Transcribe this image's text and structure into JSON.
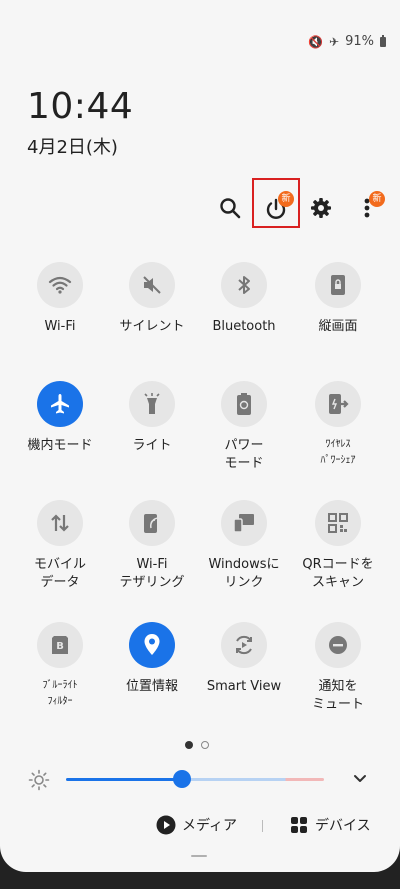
{
  "status": {
    "battery": "91%"
  },
  "clock": {
    "time": "10:44",
    "date": "4月2日(木)"
  },
  "toolbar": {
    "power_badge": "新",
    "menu_badge": "新"
  },
  "tiles": [
    {
      "label": "Wi-Fi",
      "icon": "wifi-icon"
    },
    {
      "label": "サイレント",
      "icon": "mute-icon"
    },
    {
      "label": "Bluetooth",
      "icon": "bluetooth-icon"
    },
    {
      "label": "縦画面",
      "icon": "portrait-lock-icon"
    },
    {
      "label": "機内モード",
      "icon": "airplane-icon",
      "active": true
    },
    {
      "label": "ライト",
      "icon": "flashlight-icon"
    },
    {
      "label": "パワー\nモード",
      "icon": "power-mode-icon"
    },
    {
      "label": "ﾜｲﾔﾚｽ\nﾊﾟﾜｰｼｪｱ",
      "icon": "wireless-powershare-icon"
    },
    {
      "label": "モバイル\nデータ",
      "icon": "mobile-data-icon"
    },
    {
      "label": "Wi-Fi\nテザリング",
      "icon": "hotspot-icon"
    },
    {
      "label": "Windowsに\nリンク",
      "icon": "link-to-windows-icon"
    },
    {
      "label": "QRコードを\nスキャン",
      "icon": "qr-code-icon"
    },
    {
      "label": "ﾌﾞﾙｰﾗｲﾄ\nﾌｨﾙﾀｰ",
      "icon": "blue-light-filter-icon"
    },
    {
      "label": "位置情報",
      "icon": "location-icon",
      "active": true
    },
    {
      "label": "Smart View",
      "icon": "smart-view-icon"
    },
    {
      "label": "通知を\nミュート",
      "icon": "mute-notifications-icon"
    }
  ],
  "brightness": {
    "level_fraction": 0.45
  },
  "footer": {
    "media_label": "メディア",
    "devices_label": "デバイス"
  },
  "colors": {
    "accent": "#1a73e8",
    "badge": "#f26b1d",
    "highlight": "#d92121"
  }
}
